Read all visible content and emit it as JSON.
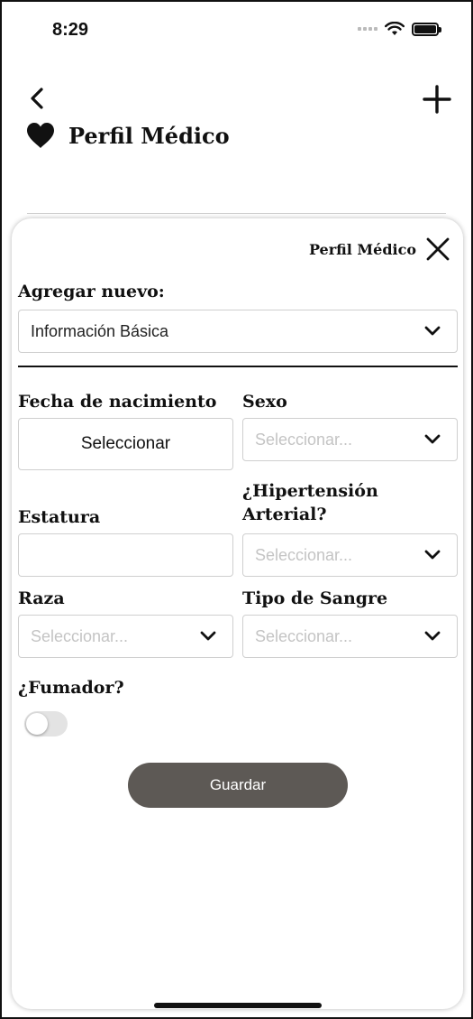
{
  "status_bar": {
    "time": "8:29"
  },
  "header": {
    "title": "Perfil Médico",
    "icons": {
      "back": "chevron-left-icon",
      "add": "plus-icon",
      "heart": "heart-icon"
    }
  },
  "sheet": {
    "title": "Perfil Médico",
    "add_new_label": "Agregar nuevo:",
    "add_new_selected": "Información Básica",
    "fields": {
      "birth_date": {
        "label": "Fecha de nacimiento",
        "button": "Seleccionar"
      },
      "sex": {
        "label": "Sexo",
        "placeholder": "Seleccionar..."
      },
      "height": {
        "label": "Estatura",
        "value": ""
      },
      "hypertension": {
        "label_line1": "¿Hipertensión",
        "label_line2": "Arterial?",
        "placeholder": "Seleccionar..."
      },
      "race": {
        "label": "Raza",
        "placeholder": "Seleccionar..."
      },
      "blood_type": {
        "label": "Tipo de Sangre",
        "placeholder": "Seleccionar..."
      },
      "smoker": {
        "label": "¿Fumador?",
        "on": false
      }
    },
    "save_label": "Guardar"
  },
  "colors": {
    "save_button": "#5d5955",
    "border": "#cfcfcf",
    "placeholder": "#c4c4c4"
  }
}
